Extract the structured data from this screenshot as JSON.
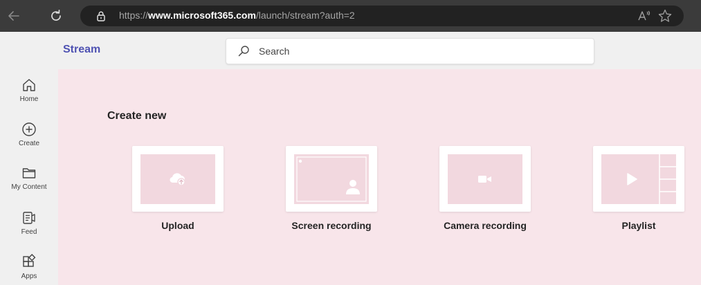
{
  "browser": {
    "url_scheme": "https://",
    "url_host": "www.microsoft365.com",
    "url_path": "/launch/stream?auth=2"
  },
  "app": {
    "title": "Stream",
    "search_placeholder": "Search",
    "accent_color": "#4f52b2"
  },
  "rail": {
    "items": [
      {
        "label": "Home",
        "icon": "home-icon"
      },
      {
        "label": "Create",
        "icon": "plus-circle-icon"
      },
      {
        "label": "My Content",
        "icon": "folder-icon"
      },
      {
        "label": "Feed",
        "icon": "feed-icon"
      },
      {
        "label": "Apps",
        "icon": "apps-icon"
      }
    ]
  },
  "main": {
    "section_title": "Create new",
    "cards": [
      {
        "label": "Upload",
        "icon": "cloud-upload-icon"
      },
      {
        "label": "Screen recording",
        "icon": "screen-recording-icon"
      },
      {
        "label": "Camera recording",
        "icon": "camera-icon"
      },
      {
        "label": "Playlist",
        "icon": "play-icon"
      }
    ],
    "background_color": "#f8e5ea"
  }
}
